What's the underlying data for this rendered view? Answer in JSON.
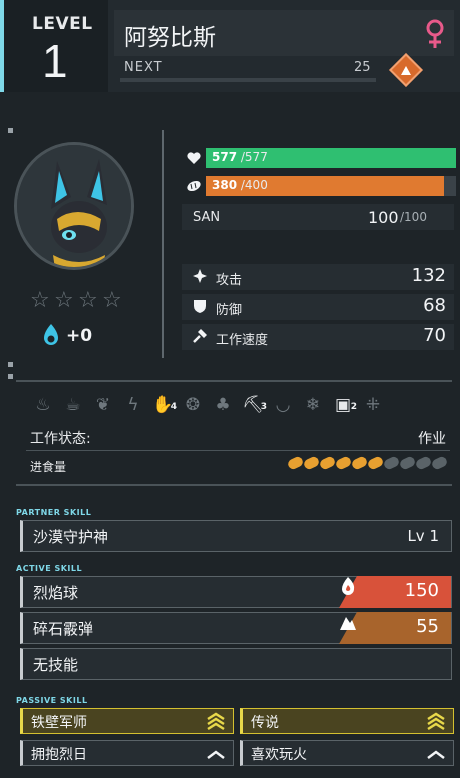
{
  "header": {
    "level_label": "LEVEL",
    "level": "1",
    "name": "阿努比斯",
    "gender": "female",
    "next_label": "NEXT",
    "next_value": "25"
  },
  "profile": {
    "stars_total": 4,
    "stars_filled": 0,
    "soul_bonus": "+0"
  },
  "vitals": {
    "hp_current": "577",
    "hp_max": " /577",
    "hp_fraction": 1.0,
    "hunger_current": "380",
    "hunger_max": " /400",
    "hunger_fraction": 0.95,
    "san_label": "SAN",
    "san_current": "100",
    "san_max": "/100"
  },
  "stats": [
    {
      "icon": "attack-icon",
      "label": "攻击",
      "value": "132"
    },
    {
      "icon": "defense-icon",
      "label": "防御",
      "value": "68"
    },
    {
      "icon": "work-speed-icon",
      "label": "工作速度",
      "value": "70"
    }
  ],
  "work_suitability": [
    {
      "icon": "kindling-icon",
      "active": false,
      "level": ""
    },
    {
      "icon": "watering-icon",
      "active": false,
      "level": ""
    },
    {
      "icon": "planting-icon",
      "active": false,
      "level": ""
    },
    {
      "icon": "electricity-icon",
      "active": false,
      "level": ""
    },
    {
      "icon": "handiwork-icon",
      "active": true,
      "level": "4"
    },
    {
      "icon": "gathering-icon",
      "active": false,
      "level": ""
    },
    {
      "icon": "lumbering-icon",
      "active": false,
      "level": ""
    },
    {
      "icon": "mining-icon",
      "active": true,
      "level": "3"
    },
    {
      "icon": "medicine-icon",
      "active": false,
      "level": ""
    },
    {
      "icon": "cooling-icon",
      "active": false,
      "level": ""
    },
    {
      "icon": "transporting-icon",
      "active": true,
      "level": "2"
    },
    {
      "icon": "farming-icon",
      "active": false,
      "level": ""
    }
  ],
  "work_state": {
    "label": "工作状态:",
    "value": "作业"
  },
  "food": {
    "label": "进食量",
    "total": 10,
    "filled": 6
  },
  "partner_skill": {
    "section_label": "PARTNER SKILL",
    "name": "沙漠守护神",
    "level": "Lv 1"
  },
  "active_skills": {
    "section_label": "ACTIVE SKILL",
    "items": [
      {
        "name": "烈焰球",
        "element": "fire",
        "power": "150",
        "color": "#d8523a"
      },
      {
        "name": "碎石霰弹",
        "element": "ground",
        "power": "55",
        "color": "#a8642c"
      },
      {
        "name": "无技能",
        "element": "",
        "power": "",
        "color": ""
      }
    ]
  },
  "passive_skills": {
    "section_label": "PASSIVE SKILL",
    "items": [
      {
        "name": "铁壁军师",
        "tier": "gold",
        "rank": 3
      },
      {
        "name": "传说",
        "tier": "gold",
        "rank": 3
      },
      {
        "name": "拥抱烈日",
        "tier": "normal",
        "rank": 1
      },
      {
        "name": "喜欢玩火",
        "tier": "normal",
        "rank": 1
      }
    ]
  },
  "colors": {
    "accent": "#7fd8e8",
    "hp": "#2fbf71",
    "hunger": "#e07a30",
    "gender": "#e85a8a",
    "gold": "#e8d84a"
  }
}
